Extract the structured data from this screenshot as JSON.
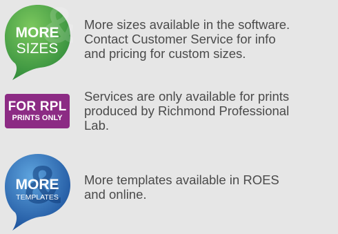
{
  "items": [
    {
      "badge": {
        "line1": "MORE",
        "line2": "SIZES",
        "color": "#3d9b3f",
        "color_light": "#6fc05a",
        "watermark": "&",
        "icon": "speech-bubble-icon"
      },
      "text": "More sizes available in the software.\nContact Customer Service for info\nand pricing for custom sizes."
    },
    {
      "badge": {
        "line1": "FOR RPL",
        "line2": "PRINTS ONLY",
        "color": "#8c2b84",
        "icon": "label-badge"
      },
      "text": "Services are only available for prints\nproduced by Richmond Professional\nLab."
    },
    {
      "badge": {
        "line1": "MORE",
        "line2": "TEMPLATES",
        "color": "#1f5aa6",
        "color_light": "#5b9bd8",
        "watermark": "&",
        "icon": "speech-bubble-icon"
      },
      "text": "More templates available in ROES\nand online."
    }
  ]
}
